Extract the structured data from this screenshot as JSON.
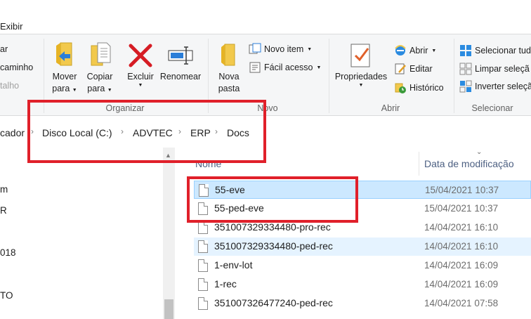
{
  "ribbon": {
    "tab_label": "Exibir",
    "left_cut": {
      "line1": "ar",
      "line2": "caminho",
      "line3": "talho"
    },
    "organizar": {
      "group_label": "Organizar",
      "move_line1": "Mover",
      "move_line2": "para",
      "copy_line1": "Copiar",
      "copy_line2": "para",
      "delete_label": "Excluir",
      "rename_label": "Renomear"
    },
    "novo": {
      "group_label": "Novo",
      "new_folder_line1": "Nova",
      "new_folder_line2": "pasta",
      "new_item_label": "Novo item",
      "easy_access_label": "Fácil acesso"
    },
    "abrir": {
      "group_label": "Abrir",
      "properties_label": "Propriedades",
      "open_label": "Abrir",
      "edit_label": "Editar",
      "history_label": "Histórico"
    },
    "selecionar": {
      "group_label": "Selecionar",
      "select_all_label": "Selecionar tud",
      "select_none_label": "Limpar seleçã",
      "invert_label": "Inverter seleçã"
    }
  },
  "address": {
    "crumbs": [
      "cador",
      "Disco Local (C:)",
      "ADVTEC",
      "ERP",
      "Docs"
    ]
  },
  "nav": {
    "items": [
      "m",
      "R",
      "018",
      "TO"
    ]
  },
  "file_list": {
    "header_name": "Nome",
    "header_date": "Data de modificação",
    "rows": [
      {
        "name": "55-eve",
        "date": "15/04/2021 10:37"
      },
      {
        "name": "55-ped-eve",
        "date": "15/04/2021 10:37"
      },
      {
        "name": "351007329334480-pro-rec",
        "date": "14/04/2021 16:10"
      },
      {
        "name": "351007329334480-ped-rec",
        "date": "14/04/2021 16:10"
      },
      {
        "name": "1-env-lot",
        "date": "14/04/2021 16:09"
      },
      {
        "name": "1-rec",
        "date": "14/04/2021 16:09"
      },
      {
        "name": "351007326477240-ped-rec",
        "date": "14/04/2021 07:58"
      }
    ]
  },
  "colors": {
    "annotation_red": "#e0202a",
    "selection_blue": "#cce8ff",
    "ribbon_bg": "#f5f6f7"
  },
  "icons": [
    "move-to-icon",
    "copy-to-icon",
    "delete-icon",
    "rename-icon",
    "new-folder-icon",
    "new-item-icon",
    "easy-access-icon",
    "properties-icon",
    "open-icon",
    "edit-icon",
    "history-icon",
    "select-all-icon",
    "select-none-icon",
    "invert-selection-icon",
    "file-icon"
  ]
}
